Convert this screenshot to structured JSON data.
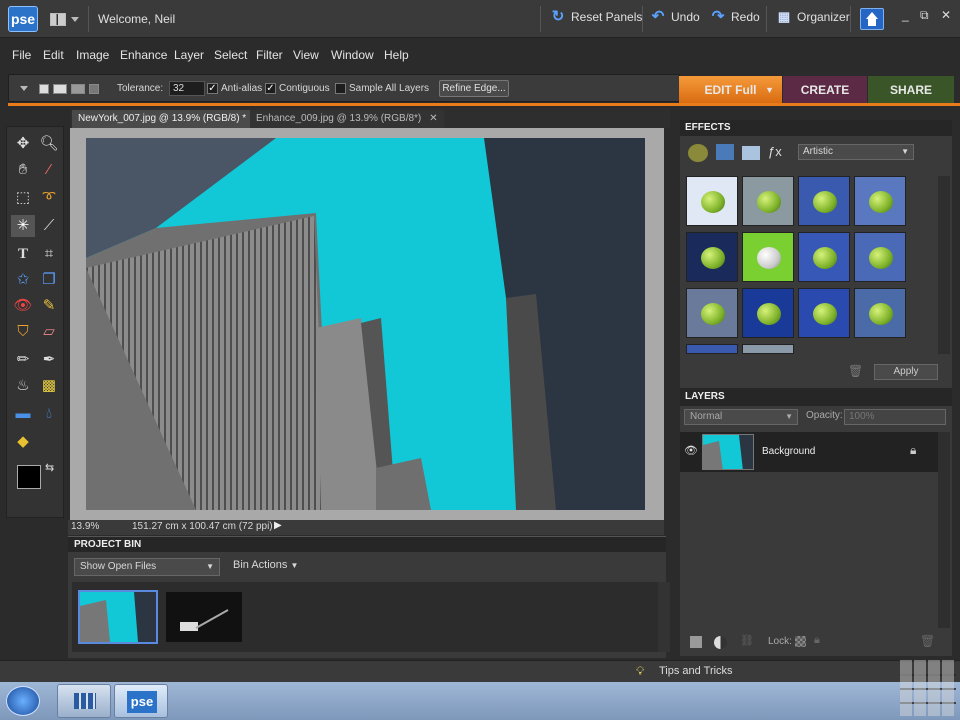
{
  "app": {
    "logo": "pse",
    "welcome": "Welcome, Neil"
  },
  "titlebar": {
    "reset_panels": "Reset Panels",
    "undo": "Undo",
    "redo": "Redo",
    "organizer": "Organizer",
    "window_controls": [
      "_",
      "⧉",
      "✕"
    ]
  },
  "menu": [
    "File",
    "Edit",
    "Image",
    "Enhance",
    "Layer",
    "Select",
    "Filter",
    "View",
    "Window",
    "Help"
  ],
  "options": {
    "tolerance_label": "Tolerance:",
    "tolerance_value": "32",
    "anti_alias": "Anti-alias",
    "contiguous": "Contiguous",
    "sample_all_layers": "Sample All Layers",
    "refine_edge": "Refine Edge..."
  },
  "modes": {
    "edit": "EDIT Full",
    "create": "CREATE",
    "share": "SHARE"
  },
  "colors": {
    "accent": "#e87c1a",
    "edit_tab": "#e87c1a",
    "create_tab": "#6b2e4e",
    "share_tab": "#3d5e2a",
    "selection": "#12c8d6"
  },
  "doc_tabs": [
    {
      "label": "NewYork_007.jpg @ 13.9% (RGB/8) *",
      "active": true
    },
    {
      "label": "Enhance_009.jpg @ 13.9% (RGB/8*)",
      "active": false
    }
  ],
  "status": {
    "zoom": "13.9%",
    "doc_size": "151.27 cm x 100.47 cm (72 ppi)"
  },
  "project_bin": {
    "title": "PROJECT BIN",
    "show": "Show Open Files",
    "bin_actions": "Bin Actions"
  },
  "effects": {
    "title": "EFFECTS",
    "category": "Artistic",
    "apply": "Apply"
  },
  "layers": {
    "title": "LAYERS",
    "blend_mode": "Normal",
    "opacity_label": "Opacity:",
    "opacity_value": "100%",
    "layer_name": "Background",
    "lock_label": "Lock:"
  },
  "footer": {
    "tips": "Tips and Tricks"
  },
  "taskbar": {
    "pse_label": "pse"
  }
}
